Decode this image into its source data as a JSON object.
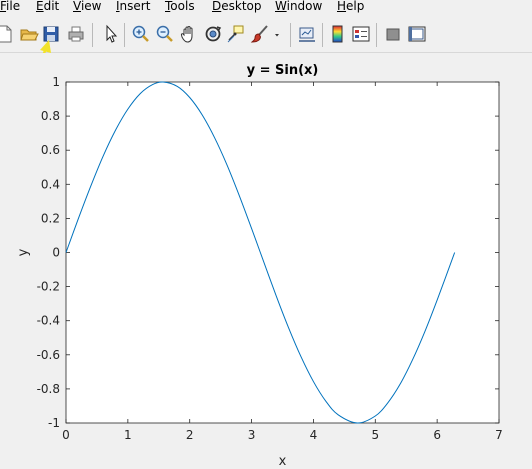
{
  "menu": {
    "items": [
      {
        "label": "File",
        "accel": "F",
        "rest": "ile"
      },
      {
        "label": "Edit",
        "accel": "E",
        "rest": "dit"
      },
      {
        "label": "View",
        "accel": "V",
        "rest": "iew"
      },
      {
        "label": "Insert",
        "accel": "I",
        "rest": "nsert"
      },
      {
        "label": "Tools",
        "accel": "T",
        "rest": "ools"
      },
      {
        "label": "Desktop",
        "accel": "D",
        "rest": "esktop"
      },
      {
        "label": "Window",
        "accel": "W",
        "rest": "indow"
      },
      {
        "label": "Help",
        "accel": "H",
        "rest": "elp"
      }
    ]
  },
  "toolbar": {
    "buttons": [
      {
        "icon": "new-figure-icon"
      },
      {
        "icon": "open-file-icon"
      },
      {
        "icon": "save-figure-icon"
      },
      {
        "icon": "print-figure-icon"
      },
      {
        "icon": "edit-plot-arrow-icon"
      },
      {
        "icon": "zoom-in-icon"
      },
      {
        "icon": "zoom-out-icon"
      },
      {
        "icon": "pan-hand-icon"
      },
      {
        "icon": "rotate-3d-icon"
      },
      {
        "icon": "data-cursor-icon"
      },
      {
        "icon": "brush-icon"
      },
      {
        "icon": "brush-dropdown-icon"
      },
      {
        "icon": "link-plot-icon"
      },
      {
        "icon": "insert-colorbar-icon"
      },
      {
        "icon": "insert-legend-icon"
      },
      {
        "icon": "hide-plot-tools-icon"
      },
      {
        "icon": "show-plot-tools-icon"
      }
    ]
  },
  "annotation": {
    "color": "#f2e22a"
  },
  "chart_data": {
    "type": "line",
    "title": "y = Sin(x)",
    "xlabel": "x",
    "ylabel": "y",
    "xlim": [
      0,
      7
    ],
    "ylim": [
      -1,
      1
    ],
    "xticks": [
      "0",
      "1",
      "2",
      "3",
      "4",
      "5",
      "6",
      "7"
    ],
    "yticks": [
      "-1",
      "-0.8",
      "-0.6",
      "-0.4",
      "-0.2",
      "0",
      "0.2",
      "0.4",
      "0.6",
      "0.8",
      "1"
    ],
    "grid": false,
    "line_color": "#0072bd",
    "series": [
      {
        "x": [
          0,
          0.2,
          0.4,
          0.6,
          0.8,
          1.0,
          1.2,
          1.4,
          1.5708,
          1.8,
          2.0,
          2.2,
          2.4,
          2.6,
          2.8,
          3.0,
          3.1416,
          3.4,
          3.6,
          3.8,
          4.0,
          4.2,
          4.4,
          4.7124,
          5.0,
          5.2,
          5.4,
          5.6,
          5.8,
          6.0,
          6.2832
        ],
        "y": [
          0,
          0.199,
          0.389,
          0.565,
          0.717,
          0.841,
          0.932,
          0.985,
          1.0,
          0.974,
          0.909,
          0.808,
          0.675,
          0.516,
          0.335,
          0.141,
          0,
          -0.256,
          -0.443,
          -0.612,
          -0.757,
          -0.872,
          -0.952,
          -1.0,
          -0.959,
          -0.883,
          -0.773,
          -0.631,
          -0.465,
          -0.279,
          0
        ]
      }
    ]
  }
}
